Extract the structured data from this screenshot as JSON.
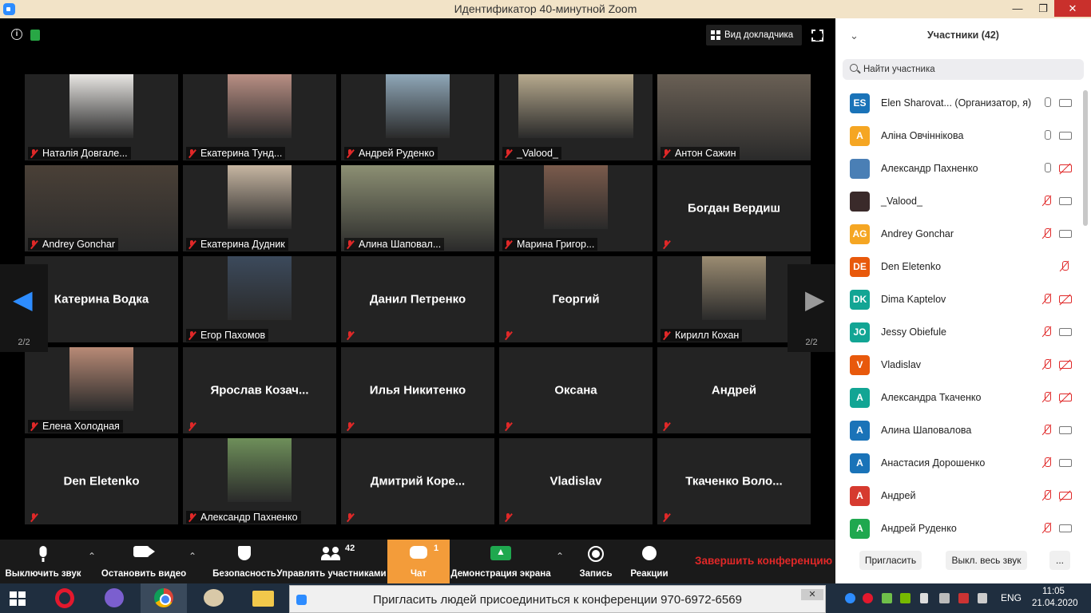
{
  "window": {
    "title": "Идентификатор 40-минутной Zoom",
    "minimize": "—",
    "maximize": "❐",
    "close": "✕"
  },
  "meeting": {
    "speaker_view_label": "Вид докладчика",
    "page_indicator": "2/2",
    "tiles": [
      {
        "name": "Наталія Довгале...",
        "video": true,
        "photo_color": "#e8e6e3"
      },
      {
        "name": "Екатерина Тунд...",
        "video": true,
        "photo_color": "#b98f84"
      },
      {
        "name": "Андрей Руденко",
        "video": true,
        "photo_color": "#8fa7b8"
      },
      {
        "name": "_Valood_",
        "video": true,
        "photo_color": "#b7aa8e"
      },
      {
        "name": "Антон Сажин",
        "video": true,
        "photo_color": "#6a6055"
      },
      {
        "name": "Andrey Gonchar",
        "video": true,
        "photo_color": "#4a4037"
      },
      {
        "name": "Екатерина Дудник",
        "video": true,
        "photo_color": "#c7b6a2"
      },
      {
        "name": "Алина Шаповал...",
        "video": true,
        "photo_color": "#8c8f73"
      },
      {
        "name": "Марина Григор...",
        "video": true,
        "photo_color": "#7b5b4c"
      },
      {
        "name": "Богдан Вердиш",
        "video": false
      },
      {
        "name": "Катерина Водка",
        "video": false
      },
      {
        "name": "Егор Пахомов",
        "video": true,
        "photo_color": "#3c4a5c"
      },
      {
        "name": "Данил Петренко",
        "video": false
      },
      {
        "name": "Георгий",
        "video": false
      },
      {
        "name": "Кирилл Кохан",
        "video": true,
        "photo_color": "#9b8c72"
      },
      {
        "name": "Елена Холодная",
        "video": true,
        "photo_color": "#b88a76"
      },
      {
        "name": "Ярослав  Козач...",
        "video": false
      },
      {
        "name": "Илья Никитенко",
        "video": false
      },
      {
        "name": "Оксана",
        "video": false
      },
      {
        "name": "Андрей",
        "video": false
      },
      {
        "name": "Den Eletenko",
        "video": false
      },
      {
        "name": "Александр Пахненко",
        "video": true,
        "photo_color": "#6e8f5a"
      },
      {
        "name": "Дмитрий  Коре...",
        "video": false
      },
      {
        "name": "Vladislav",
        "video": false
      },
      {
        "name": "Ткаченко  Воло...",
        "video": false
      }
    ]
  },
  "toolbar": {
    "mute": "Выключить звук",
    "stop_video": "Остановить видео",
    "security": "Безопасность",
    "manage_participants": "Управлять участниками",
    "participants_count": "42",
    "chat": "Чат",
    "chat_badge": "1",
    "share_screen": "Демонстрация экрана",
    "record": "Запись",
    "reactions": "Реакции",
    "end": "Завершить конференцию"
  },
  "participants_panel": {
    "title": "Участники (42)",
    "search_placeholder": "Найти участника",
    "participants": [
      {
        "initials": "ES",
        "name": "Elen Sharovat...  (Организатор, я)",
        "color": "#1a73b8",
        "mic": "on",
        "cam": "on"
      },
      {
        "initials": "А",
        "name": "Аліна Овчіннікова",
        "color": "#f5a623",
        "mic": "on",
        "cam": "on"
      },
      {
        "initials": "",
        "name": "Александр Пахненко",
        "color": "#4a7fb5",
        "mic": "on",
        "cam": "off"
      },
      {
        "initials": "",
        "name": "_Valood_",
        "color": "#3a2a2a",
        "mic": "off",
        "cam": "on"
      },
      {
        "initials": "AG",
        "name": "Andrey Gonchar",
        "color": "#f5a623",
        "mic": "off",
        "cam": "on"
      },
      {
        "initials": "DE",
        "name": "Den Eletenko",
        "color": "#e8590c",
        "mic": "off",
        "cam": "none"
      },
      {
        "initials": "DK",
        "name": "Dima Kaptelov",
        "color": "#12a594",
        "mic": "off",
        "cam": "off"
      },
      {
        "initials": "JO",
        "name": "Jessy Obiefule",
        "color": "#12a594",
        "mic": "off",
        "cam": "on"
      },
      {
        "initials": "V",
        "name": "Vladislav",
        "color": "#e8590c",
        "mic": "off",
        "cam": "off"
      },
      {
        "initials": "А",
        "name": "Александра Ткаченко",
        "color": "#12a594",
        "mic": "off",
        "cam": "off"
      },
      {
        "initials": "А",
        "name": "Алина Шаповалова",
        "color": "#1a73b8",
        "mic": "off",
        "cam": "on"
      },
      {
        "initials": "А",
        "name": "Анастасия Дорошенко",
        "color": "#1a73b8",
        "mic": "off",
        "cam": "on"
      },
      {
        "initials": "А",
        "name": "Андрей",
        "color": "#d63a2f",
        "mic": "off",
        "cam": "off"
      },
      {
        "initials": "А",
        "name": "Андрей Руденко",
        "color": "#1fa84f",
        "mic": "off",
        "cam": "on"
      }
    ],
    "invite": "Пригласить",
    "mute_all": "Выкл. весь звук",
    "more": "..."
  },
  "taskbar": {
    "notification": "Пригласить людей присоединиться к конференции 970-6972-6569",
    "notification_close": "✕",
    "lang": "ENG",
    "time": "11:05",
    "date": "21.04.2020"
  }
}
